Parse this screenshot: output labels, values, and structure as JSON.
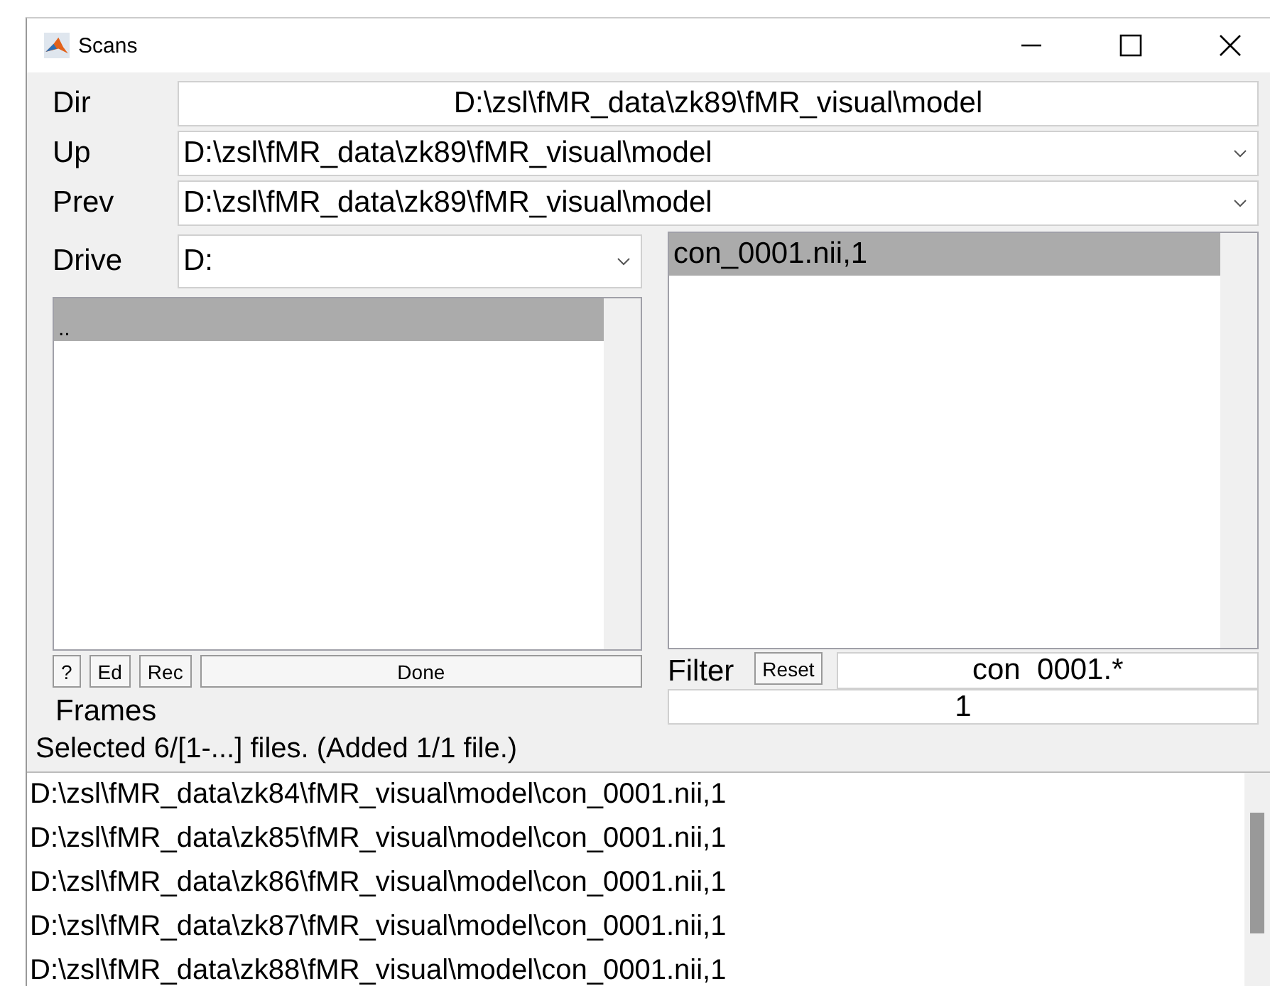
{
  "window": {
    "title": "Scans"
  },
  "dir": {
    "label": "Dir",
    "value": "D:\\zsl\\fMR_data\\zk89\\fMR_visual\\model"
  },
  "up": {
    "label": "Up",
    "value": "D:\\zsl\\fMR_data\\zk89\\fMR_visual\\model"
  },
  "prev": {
    "label": "Prev",
    "value": "D:\\zsl\\fMR_data\\zk89\\fMR_visual\\model"
  },
  "drive": {
    "label": "Drive",
    "value": "D:"
  },
  "dir_list": {
    "items": [
      {
        "text": "..",
        "selected": true
      }
    ]
  },
  "file_list": {
    "items": [
      {
        "text": "con_0001.nii,1",
        "selected": true
      }
    ]
  },
  "buttons": [
    {
      "label": "?",
      "kind": "small"
    },
    {
      "label": "Ed",
      "kind": "small"
    },
    {
      "label": "Rec",
      "kind": "small"
    },
    {
      "label": "Done",
      "kind": "wide"
    }
  ],
  "filter": {
    "label": "Filter",
    "reset": "Reset",
    "value": "con  0001.*"
  },
  "frames": {
    "label": "Frames",
    "value": "1"
  },
  "status": "Selected 6/[1-...] files. (Added 1/1 file.)",
  "selected_files": [
    "D:\\zsl\\fMR_data\\zk84\\fMR_visual\\model\\con_0001.nii,1",
    "D:\\zsl\\fMR_data\\zk85\\fMR_visual\\model\\con_0001.nii,1",
    "D:\\zsl\\fMR_data\\zk86\\fMR_visual\\model\\con_0001.nii,1",
    "D:\\zsl\\fMR_data\\zk87\\fMR_visual\\model\\con_0001.nii,1",
    "D:\\zsl\\fMR_data\\zk88\\fMR_visual\\model\\con_0001.nii,1"
  ]
}
